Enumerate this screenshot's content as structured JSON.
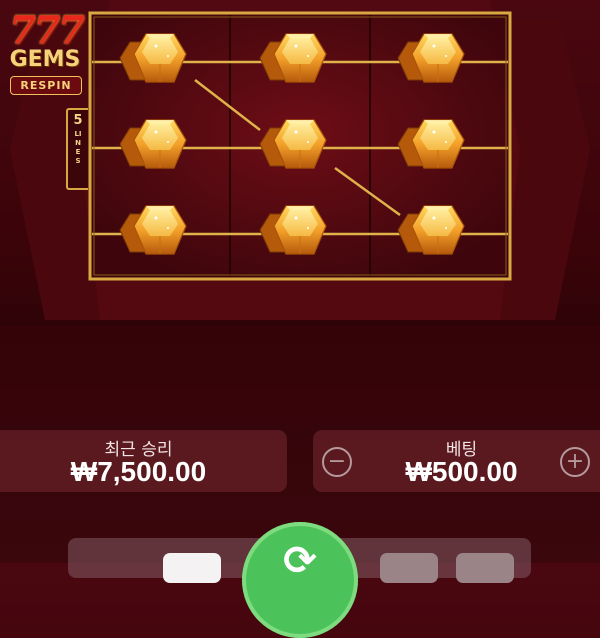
{
  "game": {
    "logo_number": "777",
    "logo_title": "GEMS",
    "logo_subtitle": "RESPIN",
    "lines_count": "5",
    "lines_word": "LINES"
  },
  "reels": {
    "columns": 3,
    "rows": 3,
    "symbol": "gem-icon",
    "symbols": [
      [
        "orange-gem",
        "orange-gem",
        "orange-gem"
      ],
      [
        "orange-gem",
        "orange-gem",
        "orange-gem"
      ],
      [
        "orange-gem",
        "orange-gem",
        "orange-gem"
      ]
    ]
  },
  "last_win": {
    "label": "최근 승리",
    "value": "₩7,500.00"
  },
  "bet": {
    "label": "베팅",
    "value": "₩500.00",
    "decrease_icon": "minus-circle-icon",
    "increase_icon": "plus-circle-icon"
  },
  "controls": {
    "spin_icon": "refresh-arrows-icon"
  },
  "colors": {
    "frame_gold": "#d8a943",
    "background": "#3a0409",
    "spin_green": "#4cc35a",
    "gem_orange": "#f3a12a"
  }
}
